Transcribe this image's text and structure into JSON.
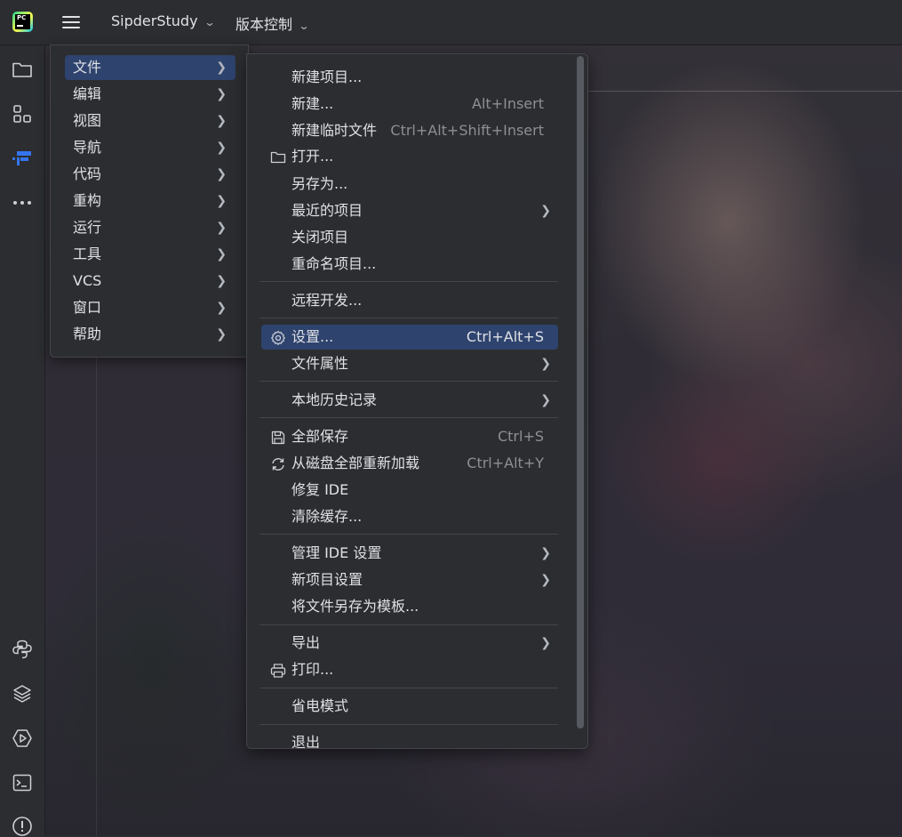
{
  "titlebar": {
    "project": "SipderStudy",
    "vcs": "版本控制",
    "logo_text": "PC"
  },
  "leftbar": {
    "icons": [
      "folder-icon",
      "structure-icon",
      "plugin-icon",
      "more-icon",
      "python-icon",
      "layers-icon",
      "run-icon",
      "terminal-icon",
      "problems-icon"
    ]
  },
  "main_menu": {
    "items": [
      {
        "label": "文件",
        "selected": true
      },
      {
        "label": "编辑"
      },
      {
        "label": "视图"
      },
      {
        "label": "导航"
      },
      {
        "label": "代码"
      },
      {
        "label": "重构"
      },
      {
        "label": "运行"
      },
      {
        "label": "工具"
      },
      {
        "label": "VCS"
      },
      {
        "label": "窗口"
      },
      {
        "label": "帮助"
      }
    ]
  },
  "file_menu": {
    "items": [
      {
        "label": "新建项目..."
      },
      {
        "label": "新建...",
        "shortcut": "Alt+Insert"
      },
      {
        "label": "新建临时文件",
        "shortcut": "Ctrl+Alt+Shift+Insert"
      },
      {
        "label": "打开...",
        "icon": "folder-icon"
      },
      {
        "label": "另存为..."
      },
      {
        "label": "最近的项目",
        "submenu": true
      },
      {
        "label": "关闭项目"
      },
      {
        "label": "重命名项目..."
      },
      {
        "label": "远程开发..."
      },
      {
        "label": "设置...",
        "shortcut": "Ctrl+Alt+S",
        "icon": "gear-icon",
        "selected": true
      },
      {
        "label": "文件属性",
        "submenu": true
      },
      {
        "label": "本地历史记录",
        "submenu": true
      },
      {
        "label": "全部保存",
        "shortcut": "Ctrl+S",
        "icon": "save-icon"
      },
      {
        "label": "从磁盘全部重新加载",
        "shortcut": "Ctrl+Alt+Y",
        "icon": "reload-icon"
      },
      {
        "label": "修复 IDE"
      },
      {
        "label": "清除缓存..."
      },
      {
        "label": "管理 IDE 设置",
        "submenu": true
      },
      {
        "label": "新项目设置",
        "submenu": true
      },
      {
        "label": "将文件另存为模板..."
      },
      {
        "label": "导出",
        "submenu": true
      },
      {
        "label": "打印...",
        "icon": "print-icon"
      },
      {
        "label": "省电模式"
      },
      {
        "label": "退出"
      }
    ]
  },
  "colors": {
    "background": "#2b2d30",
    "selection": "#2e436e",
    "text": "#dfe1e5",
    "shortcut": "#8c8f94",
    "accent": "#3574f0"
  }
}
